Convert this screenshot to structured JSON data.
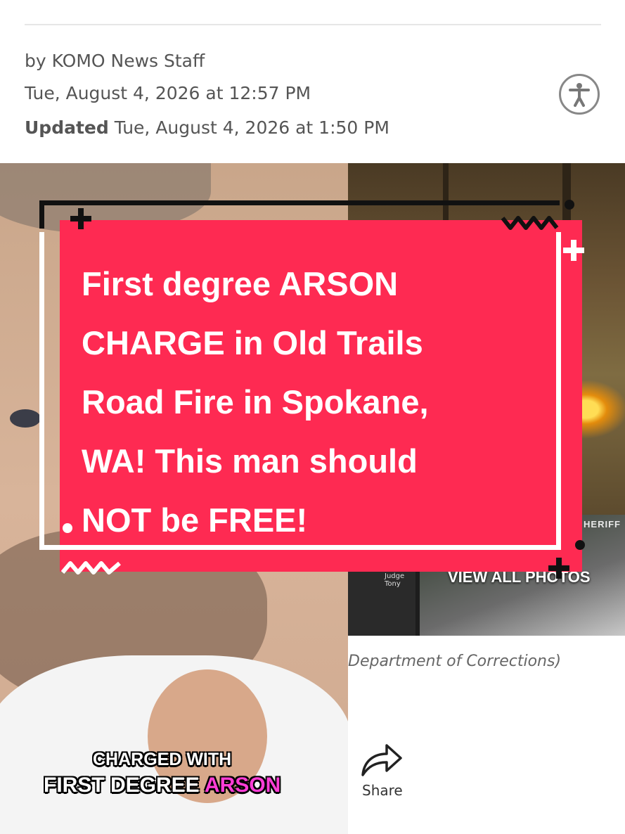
{
  "article": {
    "byline": "by KOMO News Staff",
    "published": "Tue, August 4, 2026 at 12:57 PM",
    "updated_label": "Updated",
    "updated_value": "Tue, August 4, 2026 at 1:50 PM"
  },
  "photos": {
    "thumb_label": "Judge Tony",
    "sheriff_text": "HERIFF",
    "view_all": "VIEW ALL PHOTOS",
    "caption": "Department of Corrections)"
  },
  "share": {
    "label": "Share"
  },
  "overlay": {
    "title_lines": [
      "First degree ARSON",
      "CHARGE in Old Trails",
      "Road Fire in Spokane,",
      "WA! This man should",
      "NOT be FREE!"
    ],
    "subtitle_line1": "CHARGED WITH",
    "subtitle_line2_prefix": "FIRST DEGREE ",
    "subtitle_line2_highlight": "ARSON"
  },
  "colors": {
    "card_red": "#fe2a52",
    "highlight_pink": "#ff3dd6"
  },
  "icons": {
    "accessibility": "accessibility-icon",
    "share": "share-arrow-icon"
  }
}
